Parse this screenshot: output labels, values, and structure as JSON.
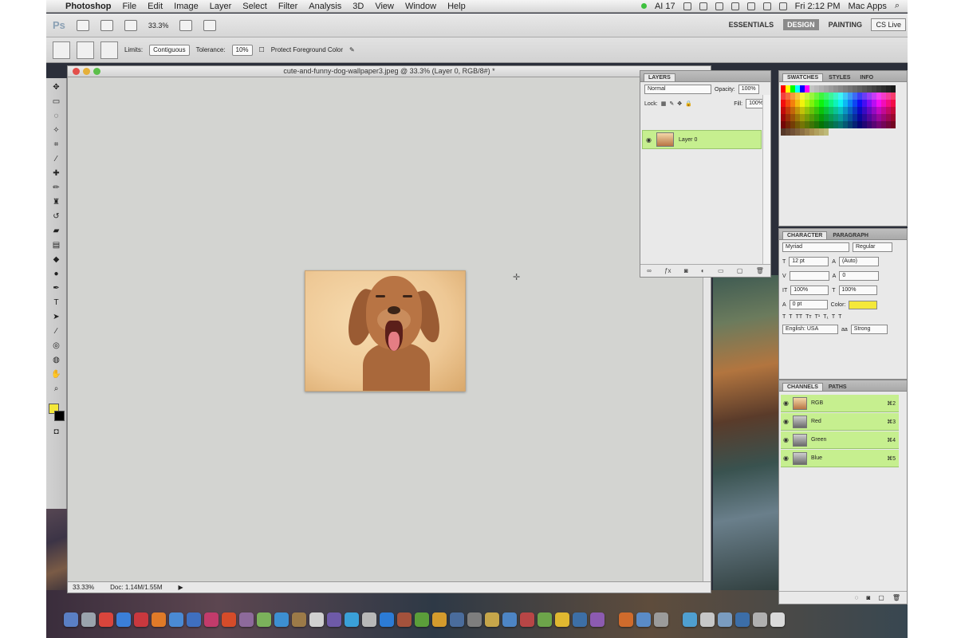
{
  "menubar": {
    "app_name": "Photoshop",
    "menus": [
      "File",
      "Edit",
      "Image",
      "Layer",
      "Select",
      "Filter",
      "Analysis",
      "3D",
      "View",
      "Window",
      "Help"
    ],
    "status_ai": "AI 17",
    "clock": "Fri 2:12 PM",
    "user": "Mac Apps"
  },
  "appbar": {
    "logo": "Ps",
    "zoom": "33.3%",
    "workspaces": [
      "ESSENTIALS",
      "DESIGN",
      "PAINTING"
    ],
    "more": "»",
    "cs_live": "CS Live"
  },
  "options": {
    "limits_label": "Limits:",
    "limits_value": "Contiguous",
    "tolerance_label": "Tolerance:",
    "tolerance_value": "10%",
    "protect_label": "Protect Foreground Color"
  },
  "document": {
    "title": "cute-and-funny-dog-wallpaper3.jpeg @ 33.3% (Layer 0, RGB/8#) *",
    "zoom_status": "33.33%",
    "doc_status": "Doc: 1.14M/1.55M"
  },
  "layers_panel": {
    "tab": "LAYERS",
    "blend_mode": "Normal",
    "opacity_label": "Opacity:",
    "opacity_value": "100%",
    "lock_label": "Lock:",
    "fill_label": "Fill:",
    "fill_value": "100%",
    "layer_name": "Layer 0"
  },
  "swatches_panel": {
    "tabs": [
      "SWATCHES",
      "STYLES",
      "INFO"
    ]
  },
  "character_panel": {
    "tabs": [
      "CHARACTER",
      "PARAGRAPH"
    ],
    "font_family": "Myriad",
    "font_style": "Regular",
    "font_size": "12 pt",
    "leading": "(Auto)",
    "tracking": "0",
    "vertical_scale": "100%",
    "horizontal_scale": "100%",
    "baseline": "0 pt",
    "color_label": "Color:",
    "language": "English: USA",
    "anti_alias_label": "aa",
    "anti_alias": "Strong",
    "color_hex": "#f4e83a"
  },
  "channels_panel": {
    "tabs": [
      "CHANNELS",
      "PATHS"
    ],
    "channels": [
      {
        "name": "RGB",
        "shortcut": "⌘2"
      },
      {
        "name": "Red",
        "shortcut": "⌘3"
      },
      {
        "name": "Green",
        "shortcut": "⌘4"
      },
      {
        "name": "Blue",
        "shortcut": "⌘5"
      }
    ]
  }
}
